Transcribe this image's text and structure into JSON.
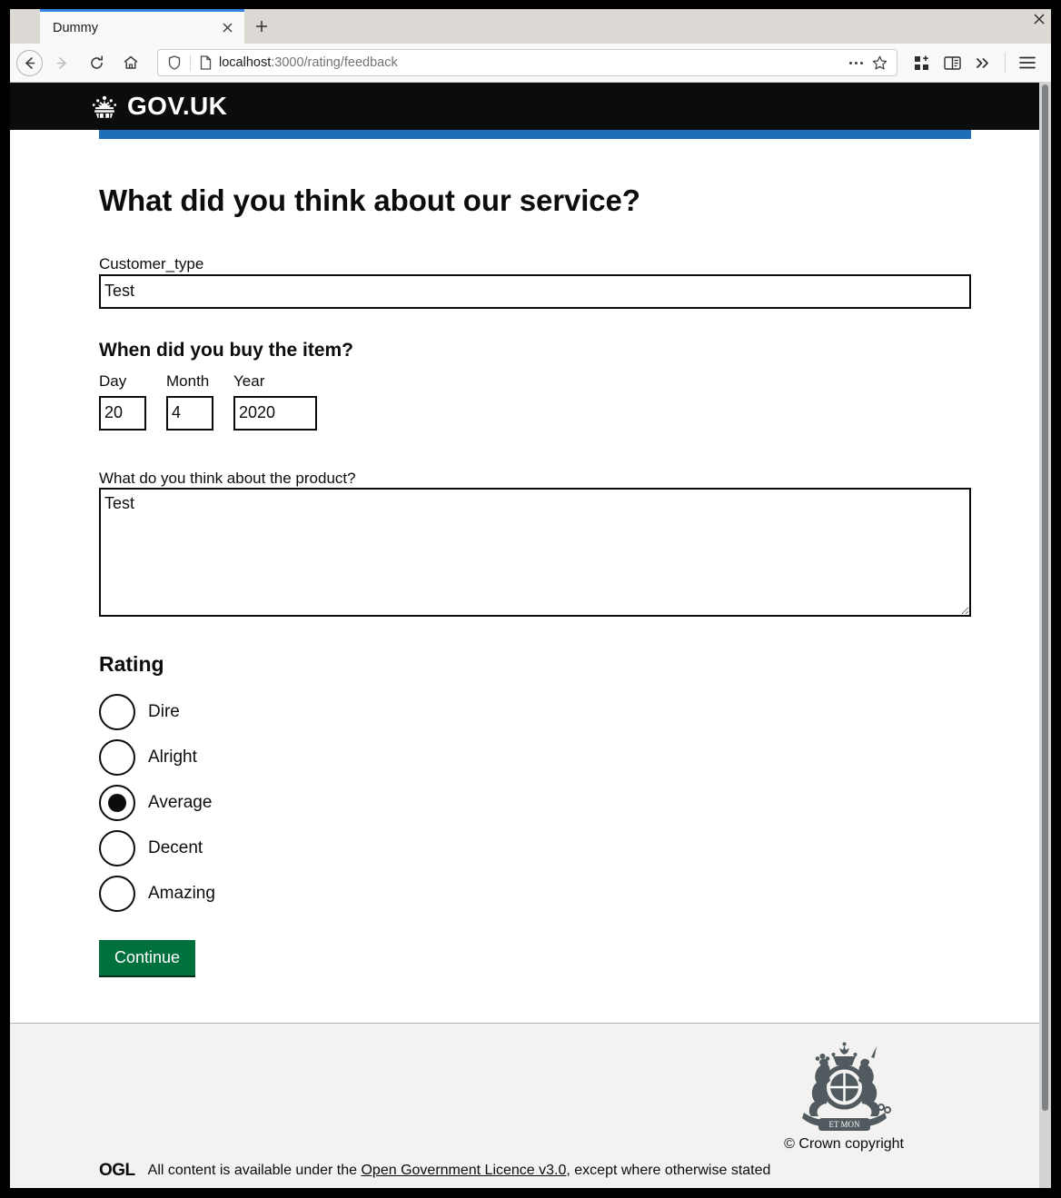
{
  "browser": {
    "tab": {
      "title": "Dummy",
      "close_icon": "close-icon"
    },
    "new_tab_label": "+",
    "window_close_label": "×",
    "nav": {
      "back_icon": "arrow-left-icon",
      "forward_icon": "arrow-right-icon",
      "reload_icon": "reload-icon",
      "home_icon": "home-icon"
    },
    "url": {
      "host": "localhost",
      "path": ":3000/rating/feedback",
      "shield_icon": "shield-icon",
      "page_icon": "page-icon",
      "more_icon": "ellipsis-icon",
      "bookmark_icon": "star-icon"
    },
    "toolbar": {
      "extensions_icon": "extensions-grid-icon",
      "reader_icon": "reader-view-icon",
      "overflow_icon": "double-chevron-right-icon",
      "menu_icon": "hamburger-menu-icon"
    }
  },
  "header": {
    "crown_icon": "govuk-crown-icon",
    "wordmark": "GOV.UK"
  },
  "main": {
    "page_title": "What did you think about our service?",
    "customer_type": {
      "label": "Customer_type",
      "value": "Test",
      "placeholder": ""
    },
    "purchase_date": {
      "legend": "When did you buy the item?",
      "fields": [
        {
          "label": "Day",
          "value": "20"
        },
        {
          "label": "Month",
          "value": "4"
        },
        {
          "label": "Year",
          "value": "2020"
        }
      ]
    },
    "product_opinion": {
      "label": "What do you think about the product?",
      "value": "Test",
      "placeholder": ""
    },
    "rating": {
      "legend": "Rating",
      "selected": "Average",
      "options": [
        {
          "label": "Dire",
          "checked": false
        },
        {
          "label": "Alright",
          "checked": false
        },
        {
          "label": "Average",
          "checked": true
        },
        {
          "label": "Decent",
          "checked": false
        },
        {
          "label": "Amazing",
          "checked": false
        }
      ]
    },
    "continue_label": "Continue"
  },
  "footer": {
    "ogl_logo": "OGL",
    "licence_prefix": "All content is available under the ",
    "licence_link": "Open Government Licence v3.0",
    "licence_suffix": ", except where otherwise stated",
    "crest_icon": "royal-coat-of-arms-icon",
    "crown_copyright": "© Crown copyright"
  },
  "colors": {
    "govuk_black": "#0b0c0c",
    "govuk_blue": "#1d70b8",
    "govuk_green": "#00703c",
    "footer_grey": "#f3f2f1",
    "tab_accent": "#3584e4"
  }
}
